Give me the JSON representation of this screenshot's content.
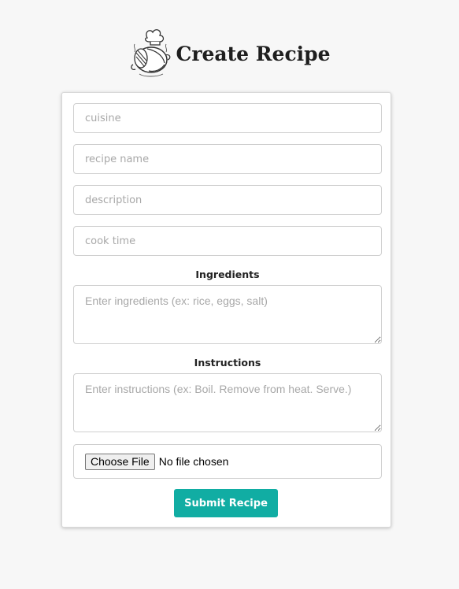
{
  "header": {
    "title": "Create Recipe",
    "logo_icon": "chef-hat-pot-icon"
  },
  "form": {
    "cuisine_placeholder": "cuisine",
    "recipe_name_placeholder": "recipe name",
    "description_placeholder": "description",
    "cook_time_placeholder": "cook time",
    "ingredients_label": "Ingredients",
    "ingredients_placeholder": "Enter ingredients (ex: rice, eggs, salt)",
    "instructions_label": "Instructions",
    "instructions_placeholder": "Enter instructions (ex: Boil. Remove from heat. Serve.)",
    "choose_file_label": "Choose File",
    "file_status": "No file chosen",
    "submit_label": "Submit Recipe"
  },
  "colors": {
    "background": "#f7f7f7",
    "accent": "#11ada3"
  }
}
